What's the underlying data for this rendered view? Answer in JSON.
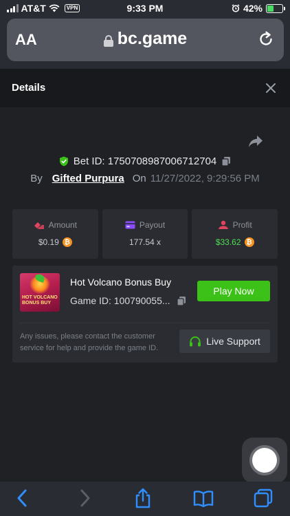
{
  "status_bar": {
    "carrier": "AT&T",
    "vpn": "VPN",
    "time": "9:33 PM",
    "battery": "42%"
  },
  "address_bar": {
    "text_size_label": "AA",
    "url": "bc.game"
  },
  "modal": {
    "title": "Details"
  },
  "bet": {
    "bet_id": "Bet ID: 1750708987006712704",
    "by_label": "By",
    "user": "Gifted Purpura",
    "on_label": "On",
    "date": "11/27/2022, 9:29:56 PM"
  },
  "stats": {
    "amount_label": "Amount",
    "amount_value": "$0.19",
    "payout_label": "Payout",
    "payout_value": "177.54 x",
    "profit_label": "Profit",
    "profit_value": "$33.62"
  },
  "game": {
    "thumbnail_text": "HOT VOLCANO BONUS BUY",
    "name": "Hot Volcano Bonus Buy",
    "game_id": "Game ID: 100790055...",
    "play_label": "Play Now",
    "issues_text": "Any issues, please contact the customer service for help and provide the game ID.",
    "support_label": "Live Support"
  },
  "colors": {
    "accent_green": "#3bc117",
    "profit_green": "#4fdf55",
    "btc_orange": "#f59322",
    "ios_blue": "#2f8fff"
  }
}
